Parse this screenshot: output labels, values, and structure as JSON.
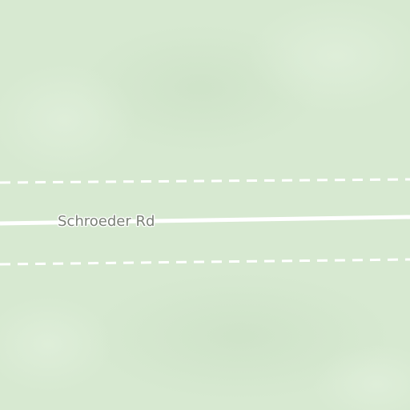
{
  "map": {
    "road": {
      "name": "Schroeder Rd"
    },
    "colors": {
      "land": "#d7e9d1",
      "land_shade": "#cfe3c9",
      "road_line": "#ffffff",
      "dashed_line": "#ffffff",
      "label_text": "#7a8076"
    }
  }
}
